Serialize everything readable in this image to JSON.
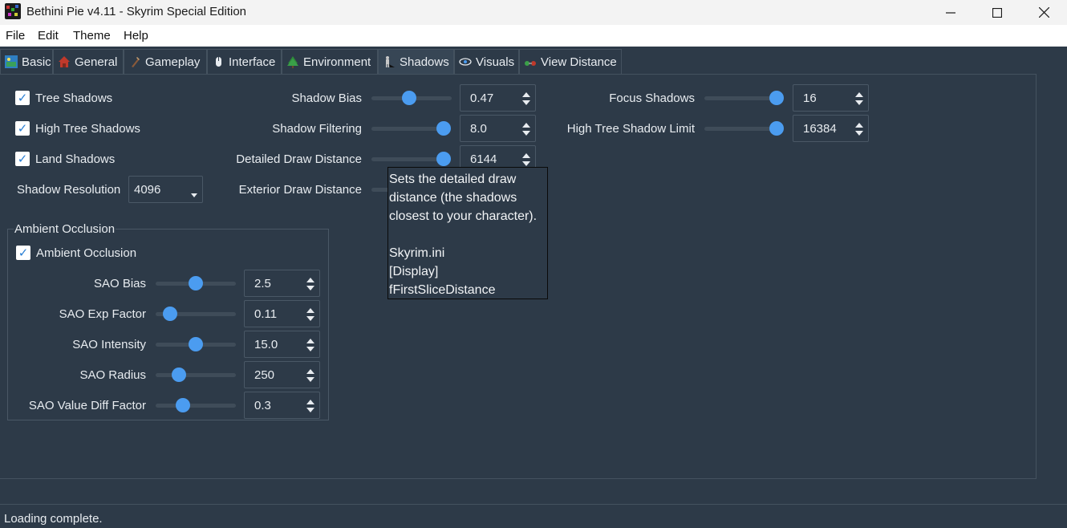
{
  "window": {
    "title": "Bethini Pie v4.11 - Skyrim Special Edition",
    "minimize": "—",
    "maximize": "□",
    "close": "✕"
  },
  "menu": [
    "File",
    "Edit",
    "Theme",
    "Help"
  ],
  "tabs": [
    {
      "label": "Basic",
      "icon": "basic-icon"
    },
    {
      "label": "General",
      "icon": "general-icon"
    },
    {
      "label": "Gameplay",
      "icon": "gameplay-icon"
    },
    {
      "label": "Interface",
      "icon": "interface-icon"
    },
    {
      "label": "Environment",
      "icon": "environment-icon"
    },
    {
      "label": "Shadows",
      "icon": "shadows-icon",
      "active": true
    },
    {
      "label": "Visuals",
      "icon": "visuals-icon"
    },
    {
      "label": "View Distance",
      "icon": "view-distance-icon"
    }
  ],
  "checks": {
    "tree_shadows": {
      "label": "Tree Shadows",
      "checked": true
    },
    "high_tree_shadows": {
      "label": "High Tree Shadows",
      "checked": true
    },
    "land_shadows": {
      "label": "Land Shadows",
      "checked": true
    },
    "ambient_occlusion": {
      "label": "Ambient Occlusion",
      "checked": true
    }
  },
  "check_mark": "✓",
  "shadow_resolution": {
    "label": "Shadow Resolution",
    "value": "4096"
  },
  "sliders": {
    "shadow_bias": {
      "label": "Shadow Bias",
      "value": "0.47",
      "level": 0.47
    },
    "shadow_filtering": {
      "label": "Shadow Filtering",
      "value": "8.0",
      "level": 1.0
    },
    "detailed_draw_distance": {
      "label": "Detailed Draw Distance",
      "value": "6144",
      "level": 1.0
    },
    "exterior_draw_distance": {
      "label": "Exterior Draw Distance"
    },
    "focus_shadows": {
      "label": "Focus Shadows",
      "value": "16",
      "level": 1.0
    },
    "high_tree_shadow_limit": {
      "label": "High Tree Shadow Limit",
      "value": "16384",
      "level": 1.0
    }
  },
  "ambient_occlusion_group": {
    "title": "Ambient Occlusion",
    "sao_bias": {
      "label": "SAO Bias",
      "value": "2.5",
      "level": 0.5
    },
    "sao_exp_factor": {
      "label": "SAO Exp Factor",
      "value": "0.11",
      "level": 0.18
    },
    "sao_intensity": {
      "label": "SAO Intensity",
      "value": "15.0",
      "level": 0.5
    },
    "sao_radius": {
      "label": "SAO Radius",
      "value": "250",
      "level": 0.29
    },
    "sao_value_diff_factor": {
      "label": "SAO Value Diff Factor",
      "value": "0.3",
      "level": 0.34
    }
  },
  "tooltip": {
    "line1": "Sets the detailed draw",
    "line2": "distance (the shadows",
    "line3": "closest to your character).",
    "line4": "Skyrim.ini",
    "line5": "[Display]",
    "line6": "fFirstSliceDistance"
  },
  "status": "Loading complete."
}
